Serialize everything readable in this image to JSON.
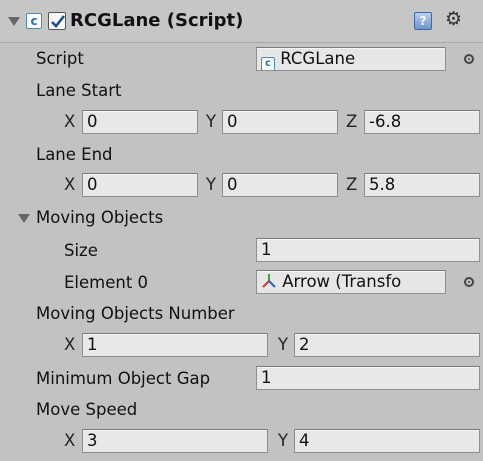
{
  "component": {
    "title": "RCGLane (Script)",
    "enabled": true
  },
  "script": {
    "label": "Script",
    "value": "RCGLane"
  },
  "lane_start": {
    "label": "Lane Start",
    "x_label": "X",
    "x": "0",
    "y_label": "Y",
    "y": "0",
    "z_label": "Z",
    "z": "-6.8"
  },
  "lane_end": {
    "label": "Lane End",
    "x_label": "X",
    "x": "0",
    "y_label": "Y",
    "y": "0",
    "z_label": "Z",
    "z": "5.8"
  },
  "moving_objects": {
    "label": "Moving Objects",
    "size_label": "Size",
    "size": "1",
    "element0_label": "Element 0",
    "element0_value": "Arrow (Transfo"
  },
  "moving_objects_number": {
    "label": "Moving Objects Number",
    "x_label": "X",
    "x": "1",
    "y_label": "Y",
    "y": "2"
  },
  "minimum_object_gap": {
    "label": "Minimum Object Gap",
    "value": "1"
  },
  "move_speed": {
    "label": "Move Speed",
    "x_label": "X",
    "x": "3",
    "y_label": "Y",
    "y": "4"
  },
  "icons": {
    "script_icon_glyph": "c",
    "help_icon_glyph": "?",
    "gear_icon_glyph": "⚙"
  },
  "colors": {
    "background": "#c2c2c2",
    "field": "#e8e8e8",
    "script_icon": "#2a6fb0"
  }
}
